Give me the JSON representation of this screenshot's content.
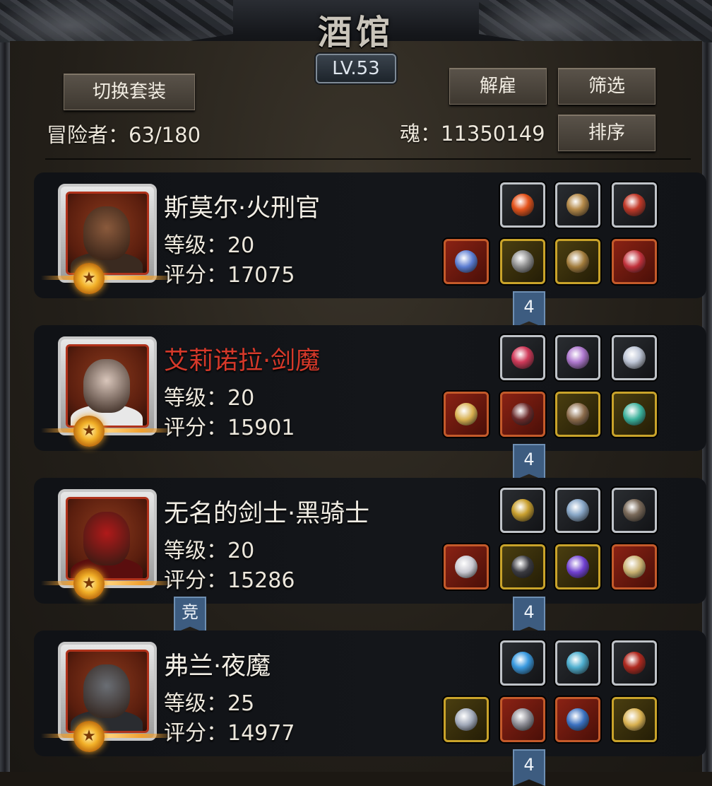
{
  "header": {
    "title": "酒馆",
    "level": "LV.53",
    "switch_suit_label": "切换套装",
    "dismiss_label": "解雇",
    "filter_label": "筛选",
    "sort_label": "排序",
    "adventurers_text": "冒险者：63/180",
    "souls_text": "魂：11350149"
  },
  "heroes": [
    {
      "name": "斯莫尔·火刑官",
      "name_color": "#f1ede4",
      "level_text": "等级：20",
      "score_text": "评分：17075",
      "badge": "4",
      "arena_badge": "",
      "portrait_skin": "#8a5a3c",
      "portrait_outfit": "#3a2a20",
      "top_slots": [
        "fire-orb-icon",
        "bone-club-icon",
        "red-spear-icon"
      ],
      "top_colors": [
        "#e5541c",
        "#b58a4a",
        "#c23a2a"
      ],
      "bottom_slots": [
        "battle-axe-icon",
        "plate-armor-icon",
        "gauntlet-icon",
        "ruby-ring-icon"
      ],
      "bottom_colors": [
        "#5a7bd0",
        "#8a8a8a",
        "#a07a3a",
        "#c0303a"
      ],
      "bottom_rarity": [
        "red",
        "yellow",
        "yellow",
        "red"
      ]
    },
    {
      "name": "艾莉诺拉·剑魔",
      "name_color": "#d6392a",
      "level_text": "等级：20",
      "score_text": "评分：15901",
      "badge": "4",
      "arena_badge": "",
      "portrait_skin": "#d9c6bb",
      "portrait_outfit": "#e8e8e8",
      "top_slots": [
        "heart-gem-icon",
        "crest-emblem-icon",
        "winged-cross-icon"
      ],
      "top_colors": [
        "#d03a5a",
        "#b07ad0",
        "#c0c8d8"
      ],
      "bottom_slots": [
        "golden-sword-icon",
        "dark-gauntlet-icon",
        "skull-mask-icon",
        "jade-bracelet-icon"
      ],
      "bottom_colors": [
        "#d8b050",
        "#6a2a2a",
        "#8a6a4a",
        "#3ab09a"
      ],
      "bottom_rarity": [
        "red",
        "red",
        "yellow",
        "yellow"
      ]
    },
    {
      "name": "无名的剑士·黑骑士",
      "name_color": "#f1ede4",
      "level_text": "等级：20",
      "score_text": "评分：15286",
      "badge": "4",
      "arena_badge": "竞",
      "portrait_skin": "#b01a1a",
      "portrait_outfit": "#5a0e0e",
      "top_slots": [
        "golden-helm-icon",
        "blue-tome-icon",
        "dark-gauntlet-icon"
      ],
      "top_colors": [
        "#c9a030",
        "#8aa8c8",
        "#7a6a5a"
      ],
      "bottom_slots": [
        "flame-sword-icon",
        "black-cloak-icon",
        "violet-ring-icon",
        "gold-amulet-icon"
      ],
      "bottom_colors": [
        "#c8c8d0",
        "#3a3a40",
        "#7040d0",
        "#c8b070"
      ],
      "bottom_rarity": [
        "red",
        "yellow",
        "yellow",
        "red"
      ]
    },
    {
      "name": "弗兰·夜魔",
      "name_color": "#f1ede4",
      "level_text": "等级：25",
      "score_text": "评分：14977",
      "badge": "4",
      "arena_badge": "",
      "portrait_skin": "#6a6e74",
      "portrait_outfit": "#2a2c30",
      "top_slots": [
        "blue-orb-icon",
        "azure-staff-icon",
        "crimson-blade-icon"
      ],
      "top_colors": [
        "#3a9ae0",
        "#50b0d0",
        "#b02a20"
      ],
      "bottom_slots": [
        "steel-dagger-icon",
        "steel-armor-icon",
        "sapphire-ring-icon",
        "sun-amulet-icon"
      ],
      "bottom_colors": [
        "#a0a8b8",
        "#8a8a92",
        "#3a70c0",
        "#d8b050"
      ],
      "bottom_rarity": [
        "yellow",
        "red",
        "red",
        "yellow"
      ]
    }
  ]
}
